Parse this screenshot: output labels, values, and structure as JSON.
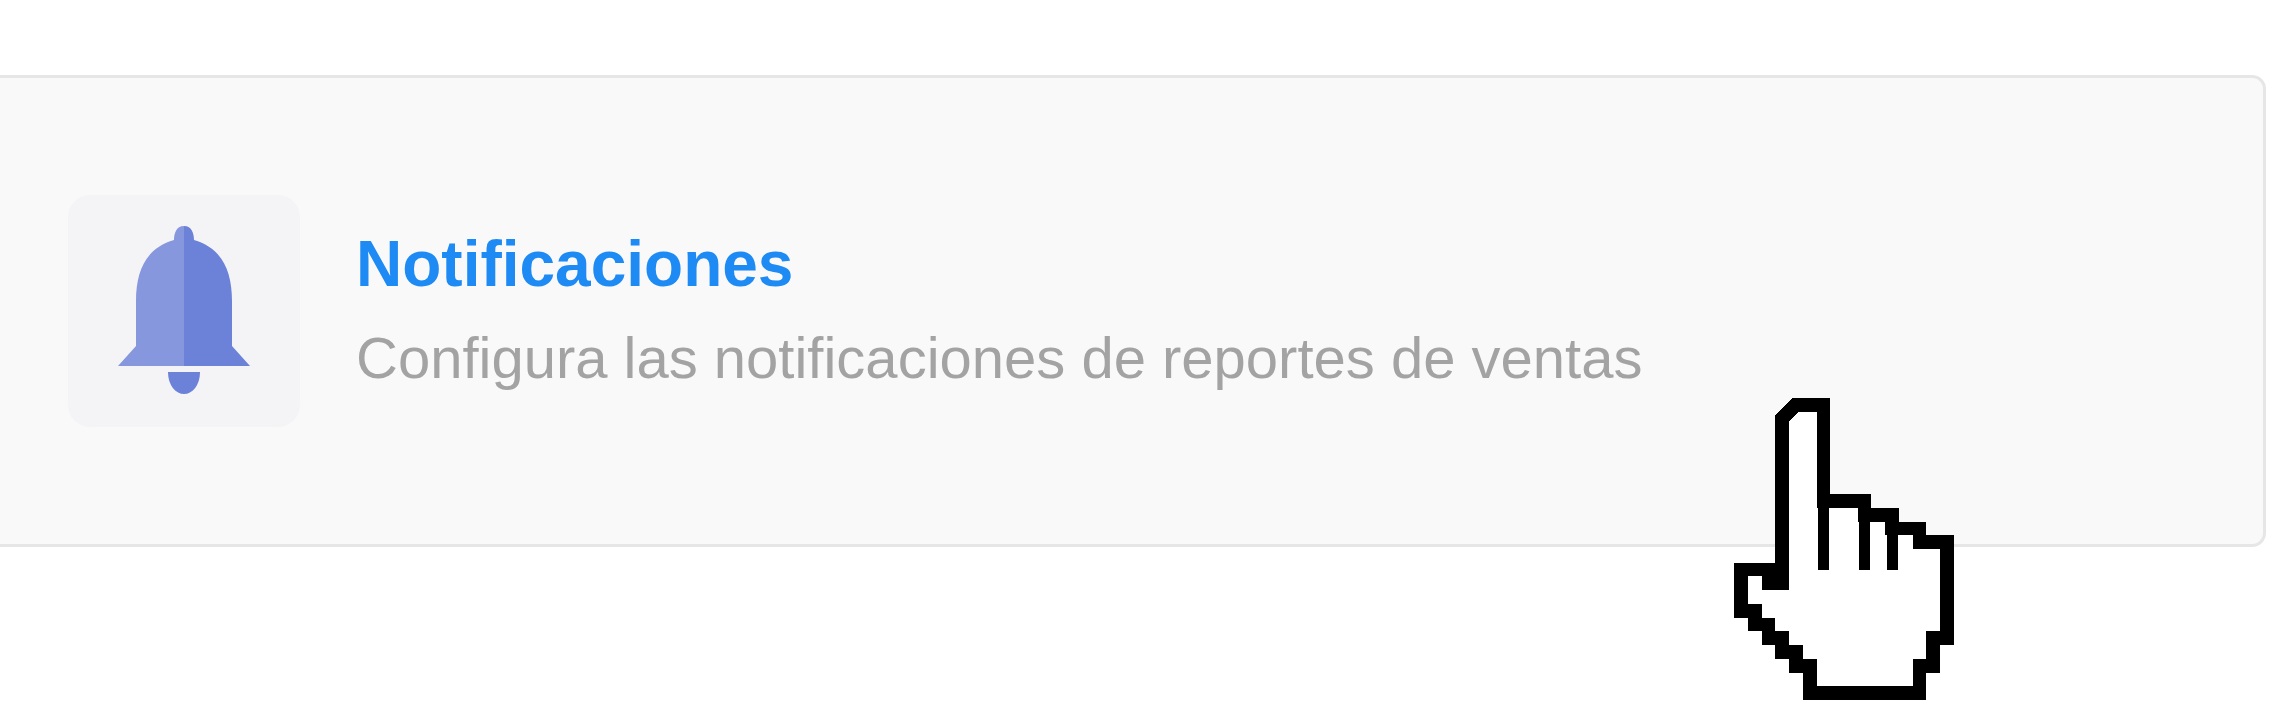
{
  "card": {
    "title": "Notificaciones",
    "description": "Configura las notificaciones de reportes de ventas"
  }
}
